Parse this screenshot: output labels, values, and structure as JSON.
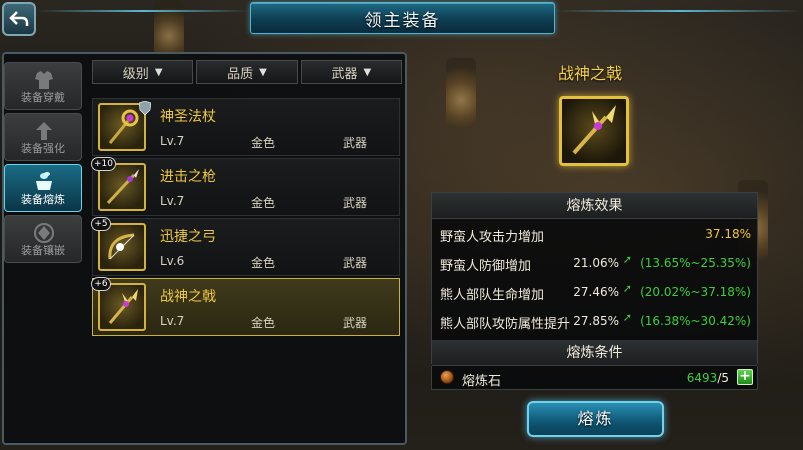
{
  "header": {
    "title": "领主装备"
  },
  "side_tabs": [
    {
      "label": "装备穿戴",
      "icon": "armor-icon",
      "active": false
    },
    {
      "label": "装备强化",
      "icon": "upgrade-icon",
      "active": false
    },
    {
      "label": "装备熔炼",
      "icon": "cauldron-icon",
      "active": true
    },
    {
      "label": "装备镶嵌",
      "icon": "gem-socket-icon",
      "active": false
    }
  ],
  "filters": [
    {
      "label": "级别"
    },
    {
      "label": "品质"
    },
    {
      "label": "武器"
    }
  ],
  "items": [
    {
      "name": "神圣法杖",
      "level": "Lv.7",
      "quality": "金色",
      "type": "武器",
      "plus": "",
      "icon": "staff-icon",
      "selected": false
    },
    {
      "name": "进击之枪",
      "level": "Lv.7",
      "quality": "金色",
      "type": "武器",
      "plus": "+10",
      "icon": "spear-icon",
      "selected": false
    },
    {
      "name": "迅捷之弓",
      "level": "Lv.6",
      "quality": "金色",
      "type": "武器",
      "plus": "+5",
      "icon": "bow-icon",
      "selected": false
    },
    {
      "name": "战神之戟",
      "level": "Lv.7",
      "quality": "金色",
      "type": "武器",
      "plus": "+6",
      "icon": "halberd-icon",
      "selected": true
    }
  ],
  "detail": {
    "name": "战神之戟",
    "icon": "halberd-icon",
    "effects_title": "熔炼效果",
    "effects": [
      {
        "label": "野蛮人攻击力增加",
        "value": "37.18%",
        "range": ""
      },
      {
        "label": "野蛮人防御增加",
        "value": "21.06%",
        "range": "(13.65%~25.35%)"
      },
      {
        "label": "熊人部队生命增加",
        "value": "27.46%",
        "range": "(20.02%~37.18%)"
      },
      {
        "label": "熊人部队攻防属性提升",
        "value": "27.85%",
        "range": "(16.38%~30.42%)"
      }
    ],
    "conditions_title": "熔炼条件",
    "requirement": {
      "label": "熔炼石",
      "have": "6493",
      "need": "/5",
      "icon": "smelting-stone-icon"
    },
    "button_label": "熔炼"
  },
  "colors": {
    "accent": "#1d6b83",
    "gold": "#f0c840",
    "green": "#3ccf3c"
  }
}
